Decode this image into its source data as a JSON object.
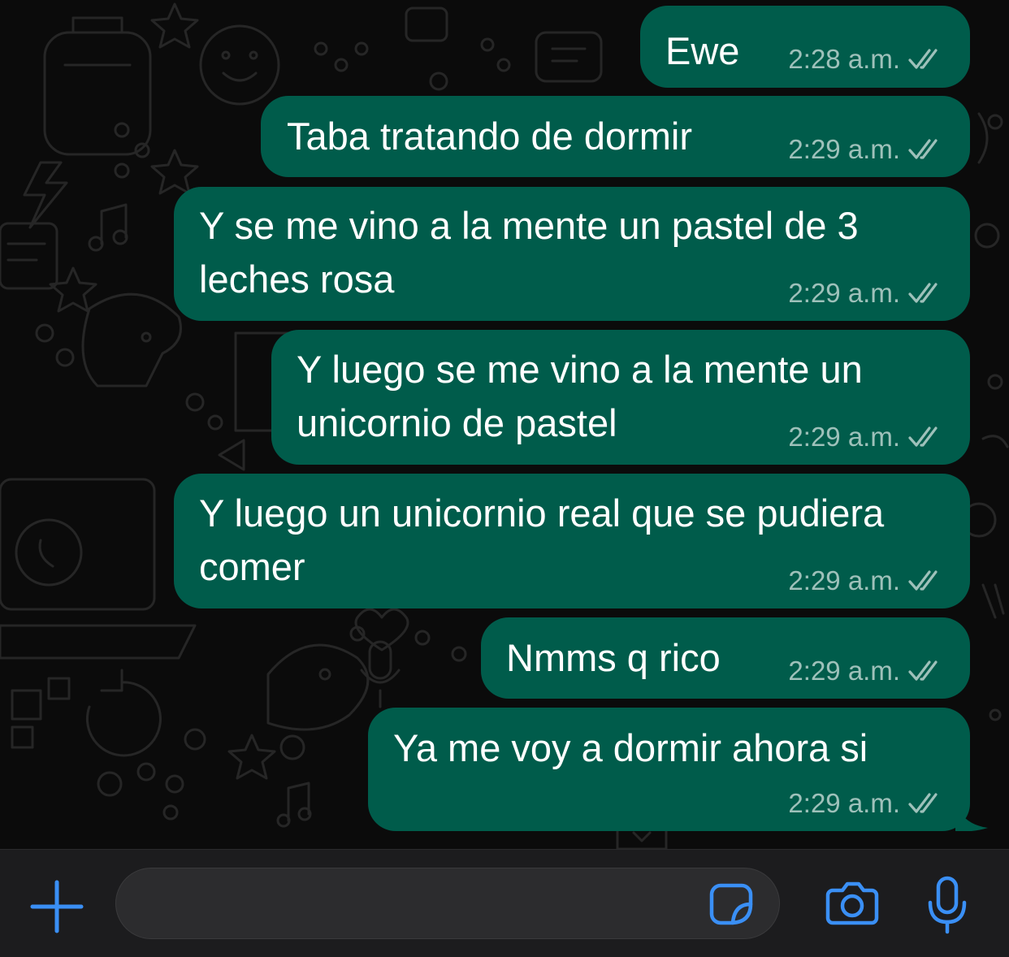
{
  "colors": {
    "background": "#0b0b0b",
    "outgoing_bubble": "#005c4b",
    "accent_blue": "#3a8ff5",
    "composer_bg": "#1c1c1e"
  },
  "messages": [
    {
      "text_lines": [
        "Ewe"
      ],
      "time": "2:28 a.m.",
      "status": "read-double-check"
    },
    {
      "text_lines": [
        "Taba tratando de dormir"
      ],
      "time": "2:29 a.m.",
      "status": "read-double-check"
    },
    {
      "text_lines": [
        "Y se me vino a la mente un pastel de 3",
        "leches rosa"
      ],
      "time": "2:29 a.m.",
      "status": "read-double-check"
    },
    {
      "text_lines": [
        "Y luego se me vino a la mente un",
        "unicornio de pastel"
      ],
      "time": "2:29 a.m.",
      "status": "read-double-check"
    },
    {
      "text_lines": [
        "Y luego un unicornio real que se pudiera",
        "comer"
      ],
      "time": "2:29 a.m.",
      "status": "read-double-check"
    },
    {
      "text_lines": [
        "Nmms q rico"
      ],
      "time": "2:29 a.m.",
      "status": "read-double-check"
    },
    {
      "text_lines": [
        "Ya me voy a dormir ahora si"
      ],
      "time": "2:29 a.m.",
      "status": "read-double-check"
    }
  ],
  "composer": {
    "attach_icon": "plus-icon",
    "input_value": "",
    "sticker_icon": "sticker-icon",
    "camera_icon": "camera-icon",
    "mic_icon": "microphone-icon"
  }
}
